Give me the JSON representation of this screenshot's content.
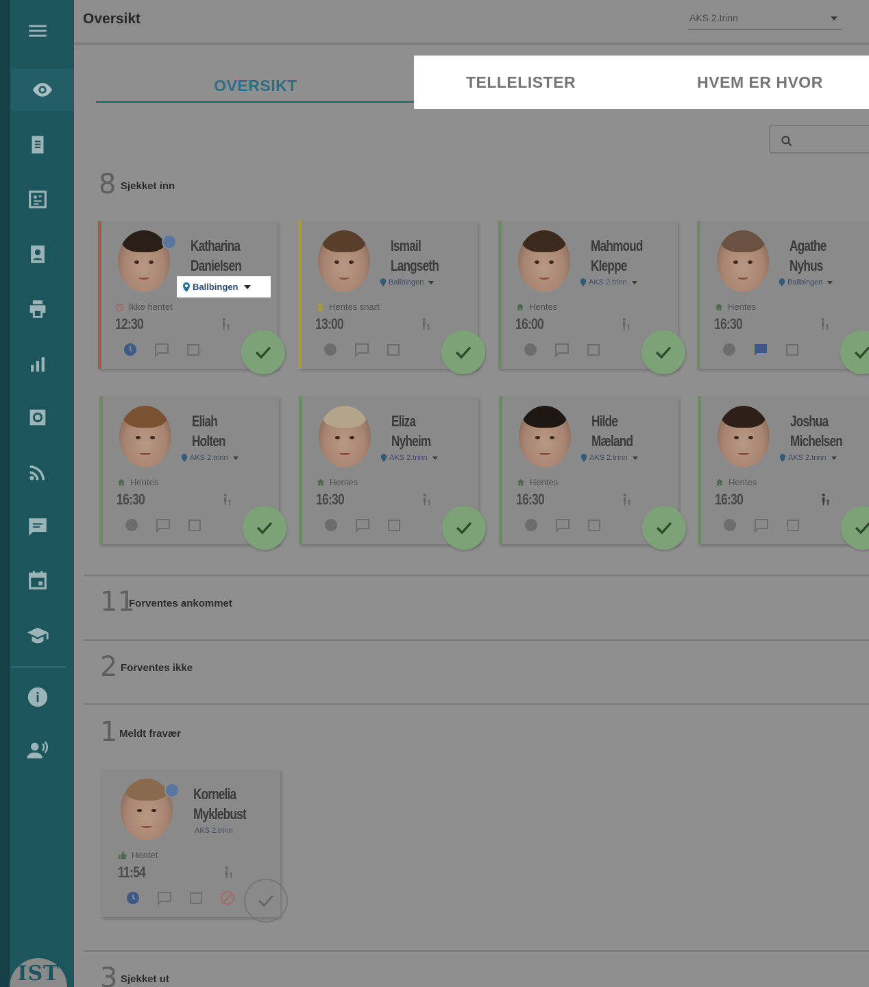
{
  "app": {
    "logo_text": "IST",
    "colors": {
      "sidebar": "#1d555d",
      "accent": "#2e6f86",
      "checked_green": "#7da277"
    }
  },
  "header": {
    "title": "Oversikt",
    "group_select": "AKS 2.trinn"
  },
  "tabs": [
    {
      "label": "OVERSIKT",
      "active": true
    },
    {
      "label": "TELLELISTER",
      "active": false
    },
    {
      "label": "HVEM ER HVOR",
      "active": false
    }
  ],
  "sidebar": {
    "items": [
      {
        "icon": "menu-icon"
      },
      {
        "icon": "eye-icon",
        "active": true
      },
      {
        "icon": "clipboard-icon"
      },
      {
        "icon": "report-icon"
      },
      {
        "icon": "contact-card-icon"
      },
      {
        "icon": "printer-icon"
      },
      {
        "icon": "bar-chart-icon"
      },
      {
        "icon": "settings-box-icon"
      },
      {
        "icon": "rss-icon"
      },
      {
        "icon": "chat-icon"
      },
      {
        "icon": "calendar-icon"
      },
      {
        "icon": "graduation-cap-icon"
      },
      {
        "icon": "info-icon"
      },
      {
        "icon": "person-voice-icon"
      }
    ]
  },
  "sections": {
    "checked_in": {
      "count": "8",
      "label": "Sjekket inn"
    },
    "expected": {
      "count": "11",
      "label": "Forventes ankommet"
    },
    "not_expected": {
      "count": "2",
      "label": "Forventes ikke"
    },
    "absent": {
      "count": "1",
      "label": "Meldt fravær"
    },
    "checked_out": {
      "count": "3",
      "label": "Sjekket ut"
    }
  },
  "children": [
    {
      "first": "Katharina",
      "last": "Danielsen",
      "location": "Ballbingen",
      "status": "Ikke hentet",
      "time": "12:30"
    },
    {
      "first": "Ismail",
      "last": "Langseth",
      "location": "Ballbingen",
      "status": "Hentes snart",
      "time": "13:00"
    },
    {
      "first": "Mahmoud",
      "last": "Kleppe",
      "location": "AKS 2.trinn",
      "status": "Hentes",
      "time": "16:00"
    },
    {
      "first": "Agathe",
      "last": "Nyhus",
      "location": "Ballbingen",
      "status": "Hentes",
      "time": "16:30"
    },
    {
      "first": "Eliah",
      "last": "Holten",
      "location": "AKS 2.trinn",
      "status": "Hentes",
      "time": "16:30"
    },
    {
      "first": "Eliza",
      "last": "Nyheim",
      "location": "AKS 2.trinn",
      "status": "Hentes",
      "time": "16:30"
    },
    {
      "first": "Hilde",
      "last": "Mæland",
      "location": "AKS 2.trinn",
      "status": "Hentes",
      "time": "16:30"
    },
    {
      "first": "Joshua",
      "last": "Michelsen",
      "location": "AKS 2.trinn",
      "status": "Hentes",
      "time": "16:30"
    }
  ],
  "absent_children": [
    {
      "first": "Kornelia",
      "last": "Myklebust",
      "location": "AKS 2.trinn",
      "status": "Hentet",
      "time": "11:54"
    }
  ]
}
